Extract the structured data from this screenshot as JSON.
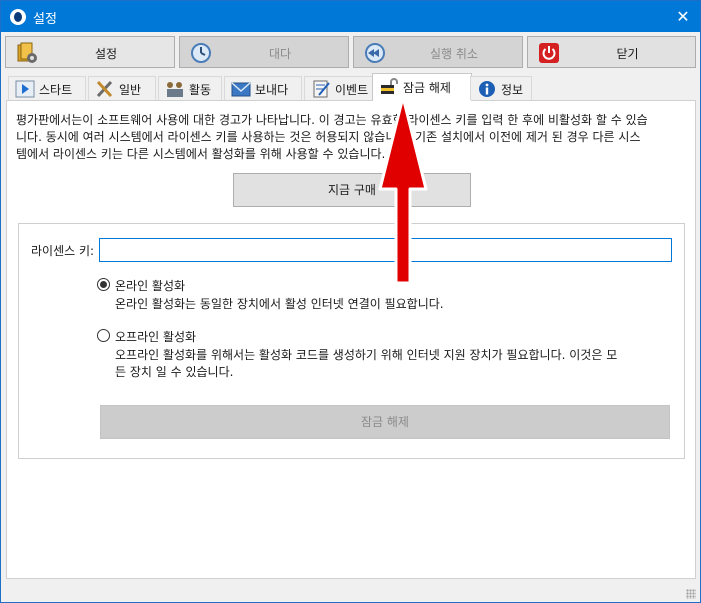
{
  "window": {
    "title": "설정",
    "close_glyph": "✕"
  },
  "toolbar": [
    {
      "label": "설정",
      "icon": "settings-icon",
      "state": "active"
    },
    {
      "label": "대다",
      "icon": "clock-icon",
      "state": "disabled"
    },
    {
      "label": "실행 취소",
      "icon": "undo-icon",
      "state": "disabled"
    },
    {
      "label": "닫기",
      "icon": "power-icon",
      "state": "normal"
    }
  ],
  "tabs": [
    {
      "label": "스타트",
      "icon": "play-icon"
    },
    {
      "label": "일반",
      "icon": "tools-icon"
    },
    {
      "label": "활동",
      "icon": "activity-icon"
    },
    {
      "label": "보내다",
      "icon": "mail-icon"
    },
    {
      "label": "이벤트",
      "icon": "notepad-icon"
    },
    {
      "label": "잠금 해제",
      "icon": "padlock-icon",
      "selected": true
    },
    {
      "label": "정보",
      "icon": "info-icon"
    }
  ],
  "unlock_panel": {
    "warning_lines": [
      "평가판에서는이 소프트웨어 사용에 대한 경고가 나타납니다. 이 경고는 유효한 라이센스 키를 입력 한 후에 비활성화 할 수 있습",
      "니다. 동시에 여러 시스템에서 라이센스 키를 사용하는 것은 허용되지 않습니다. 기존 설치에서 이전에 제거 된 경우 다른 시스",
      "템에서 라이센스 키는 다른 시스템에서 활성화를 위해 사용할 수 있습니다."
    ],
    "buy_button": "지금 구매",
    "license_key_label": "라이센스 키:",
    "license_key_value": "",
    "online": {
      "label": "온라인 활성화",
      "description": "온라인 활성화는 동일한 장치에서 활성 인터넷 연결이 필요합니다.",
      "checked": true
    },
    "offline": {
      "label": "오프라인 활성화",
      "description_lines": [
        "오프라인 활성화를 위해서는 활성화 코드를 생성하기 위해 인터넷 지원 장치가 필요합니다. 이것은 모",
        "든 장치 일 수 있습니다."
      ],
      "checked": false
    },
    "unlock_button": "잠금 해제"
  },
  "annotation": {
    "arrow_color": "#e00000",
    "arrow_outline": "#ffffff"
  }
}
